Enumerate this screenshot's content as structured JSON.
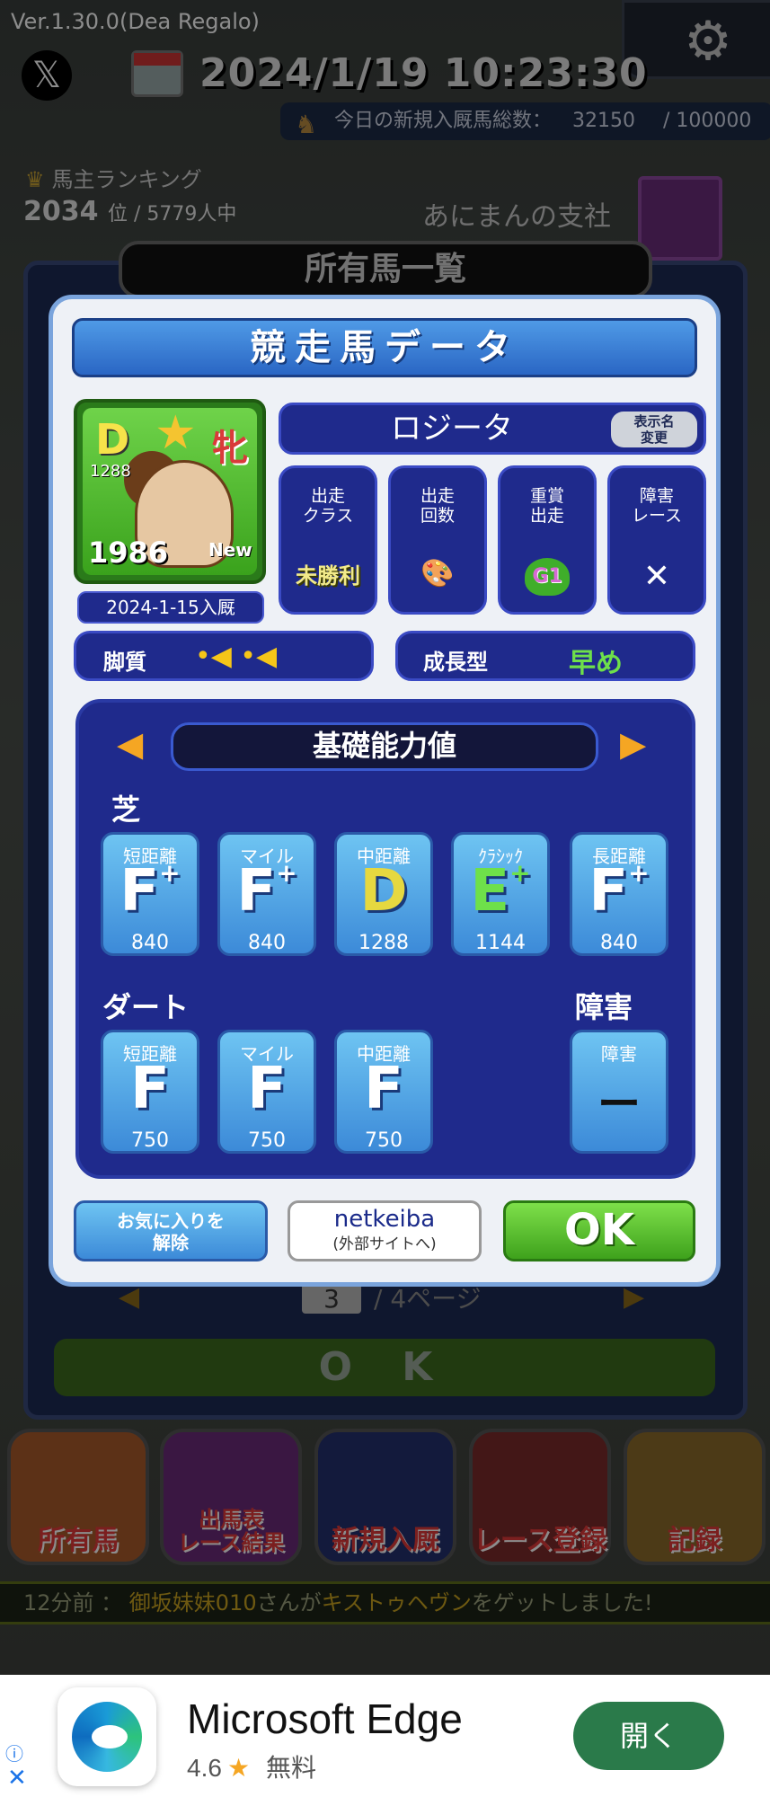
{
  "status": {
    "version": "Ver.1.30.0(Dea Regalo)",
    "x_label": "𝕏",
    "datetime": "2024/1/19  10:23:30",
    "new_horses_label": "今日の新規入厩馬総数：",
    "new_horses_count": "32150",
    "new_horses_max": "/ 100000"
  },
  "ranking": {
    "title": "馬主ランキング",
    "rank": "2034",
    "rank_unit": "位 / 5779人中",
    "owner_name": "あにまんの支社"
  },
  "list_panel": {
    "title": "所有馬一覧",
    "page": "3",
    "page_total": "/  4ページ",
    "ok": "O K"
  },
  "modal": {
    "title": "競走馬データ",
    "horse": {
      "rank": "D",
      "rank_value": "1288",
      "sex": "牝",
      "birth_year": "1986",
      "new_tag": "New",
      "entry_date": "2024-1-15入厩",
      "name": "ロジータ",
      "rename_label": "表示名\n変更"
    },
    "stats": [
      {
        "label": "出走\nクラス",
        "value": "未勝利"
      },
      {
        "label": "出走\n回数",
        "value": ""
      },
      {
        "label": "重賞\n出走",
        "value": "G1"
      },
      {
        "label": "障害\nレース",
        "value": "✕"
      }
    ],
    "style": {
      "label": "脚質",
      "value": "•◀ •◀"
    },
    "growth": {
      "label": "成長型",
      "value": "早め"
    },
    "abilities": {
      "title": "基礎能力値",
      "turf_label": "芝",
      "dirt_label": "ダート",
      "hurdle_label": "障害",
      "turf": [
        {
          "label": "短距離",
          "grade": "F",
          "plus": "+",
          "value": "840"
        },
        {
          "label": "マイル",
          "grade": "F",
          "plus": "+",
          "value": "840"
        },
        {
          "label": "中距離",
          "grade": "D",
          "plus": "",
          "value": "1288"
        },
        {
          "label": "ｸﾗｼｯｸ",
          "grade": "E",
          "plus": "+",
          "value": "1144"
        },
        {
          "label": "長距離",
          "grade": "F",
          "plus": "+",
          "value": "840"
        }
      ],
      "dirt": [
        {
          "label": "短距離",
          "grade": "F",
          "value": "750"
        },
        {
          "label": "マイル",
          "grade": "F",
          "value": "750"
        },
        {
          "label": "中距離",
          "grade": "F",
          "value": "750"
        }
      ],
      "hurdle": {
        "label": "障害",
        "grade": "ー"
      }
    },
    "buttons": {
      "favorite": "お気に入りを\n解除",
      "netkeiba": "netkeiba",
      "netkeiba_sub": "(外部サイトへ)",
      "ok": "OK"
    }
  },
  "menu": [
    {
      "label": "所有馬",
      "color": "#e8702a"
    },
    {
      "label": "出馬表\nレース結果",
      "color": "#9a3aa8"
    },
    {
      "label": "新規入厩",
      "color": "#2a3aa8"
    },
    {
      "label": "レース登録",
      "color": "#c43a3a"
    },
    {
      "label": "記録",
      "color": "#e8a82a"
    }
  ],
  "news": {
    "prefix": "12分前 ： ",
    "user": "御坂妹妹010",
    "mid": "さんが",
    "horse": "キストゥヘヴン",
    "suffix": "をゲットしました!"
  },
  "ad": {
    "title": "Microsoft Edge",
    "rating": "4.6",
    "price": "無料",
    "button": "開く",
    "info": "ⓘ",
    "close": "✕"
  }
}
